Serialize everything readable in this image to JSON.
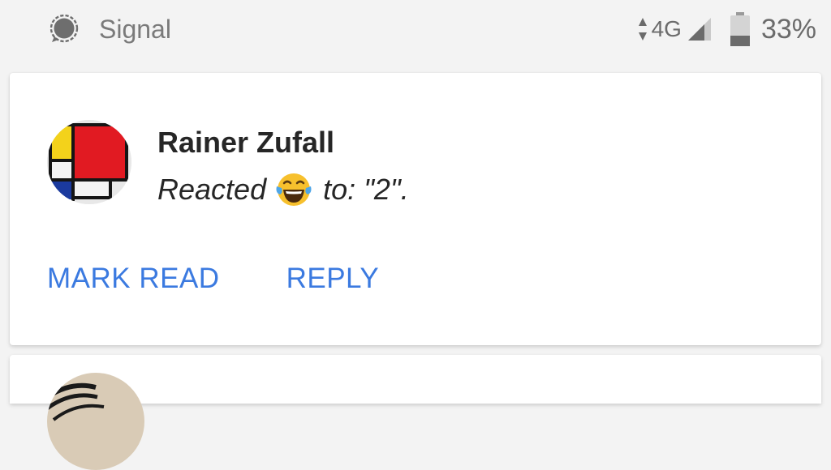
{
  "status_bar": {
    "app_icon": "signal-logo-icon",
    "app_name": "Signal",
    "network": "4G",
    "battery_percent": "33%",
    "battery_level": 0.33,
    "icons": [
      "data-activity-arrows-icon",
      "cell-signal-icon",
      "battery-icon"
    ]
  },
  "notification": {
    "avatar_icon": "mondrian-avatar",
    "sender": "Rainer Zufall",
    "message_prefix": "Reacted",
    "reaction_emoji": "face-with-tears-of-joy-emoji",
    "message_suffix": "to: \"2\".",
    "actions": {
      "mark_read": "MARK READ",
      "reply": "REPLY"
    },
    "colors": {
      "action": "#3b7ae0",
      "text": "#262626"
    }
  },
  "next_notification": {
    "avatar_icon": "contact-avatar"
  }
}
